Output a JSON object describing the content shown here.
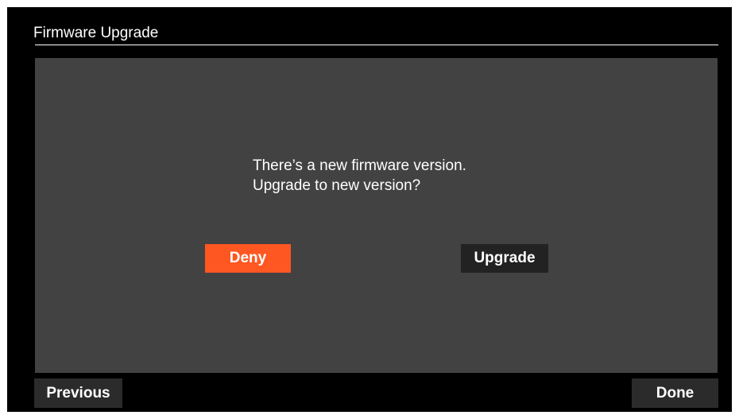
{
  "header": {
    "title": "Firmware Upgrade"
  },
  "dialog": {
    "message_line1": "There’s a new firmware version.",
    "message_line2": "Upgrade to new version?",
    "deny_label": "Deny",
    "upgrade_label": "Upgrade"
  },
  "footer": {
    "previous_label": "Previous",
    "done_label": "Done"
  },
  "colors": {
    "background": "#000000",
    "panel": "#424242",
    "accent": "#fe5722",
    "button_dark": "#222222",
    "text": "#ffffff"
  }
}
